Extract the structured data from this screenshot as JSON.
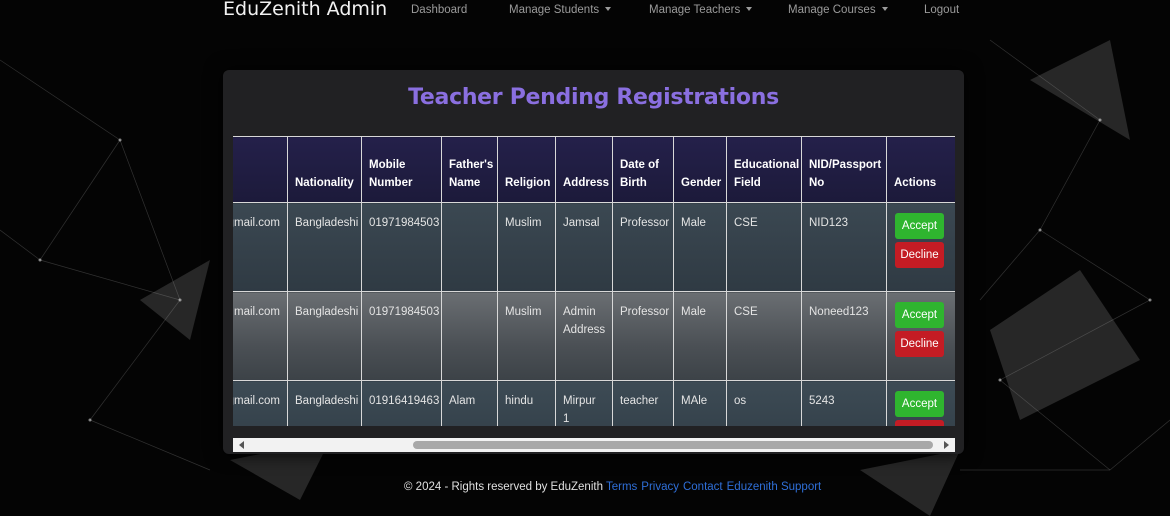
{
  "navbar": {
    "brand": "EduZenith Admin",
    "links": [
      {
        "label": "Dashboard",
        "dropdown": false
      },
      {
        "label": "Manage Students",
        "dropdown": true
      },
      {
        "label": "Manage Teachers",
        "dropdown": true
      },
      {
        "label": "Manage Courses",
        "dropdown": true
      },
      {
        "label": "Logout",
        "dropdown": false
      }
    ]
  },
  "main": {
    "title": "Teacher Pending Registrations",
    "table": {
      "columns": [
        "",
        "Nationality",
        "Mobile Number",
        "Father's Name",
        "Religion",
        "Address",
        "Date of Birth",
        "Gender",
        "Educational Field",
        "NID/Passport No",
        "Actions"
      ],
      "rows": [
        {
          "email": "gmail.com",
          "nationality": "Bangladeshi",
          "mobile": "01971984503",
          "father": "",
          "religion": "Muslim",
          "address": "Jamsal",
          "dob": "Professor",
          "gender": "Male",
          "field": "CSE",
          "nid": "NID123"
        },
        {
          "email": "mail.com",
          "nationality": "Bangladeshi",
          "mobile": "01971984503",
          "father": "",
          "religion": "Muslim",
          "address": "Admin Address",
          "dob": "Professor",
          "gender": "Male",
          "field": "CSE",
          "nid": "Noneed123"
        },
        {
          "email": "gmail.com",
          "nationality": "Bangladeshi",
          "mobile": "01916419463",
          "father": "Alam",
          "religion": "hindu",
          "address": "Mirpur 1",
          "dob": "teacher",
          "gender": "MAle",
          "field": "os",
          "nid": "5243"
        }
      ],
      "actions": {
        "accept_label": "Accept",
        "decline_label": "Decline"
      }
    }
  },
  "footer": {
    "text": "© 2024 - Rights reserved by EduZenith",
    "links": [
      "Terms",
      "Privacy",
      "Contact",
      "Eduzenith Support"
    ]
  },
  "colors": {
    "title": "#8a6fe0",
    "accept": "#2fb52f",
    "decline": "#c41c24",
    "link": "#2f6fd8",
    "header_bg": "#1c1a3a"
  }
}
